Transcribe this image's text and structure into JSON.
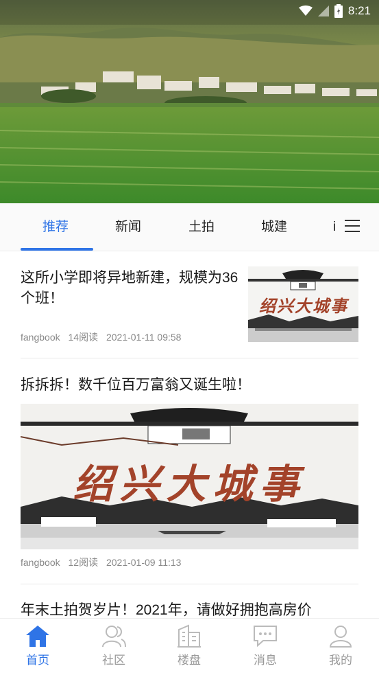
{
  "status": {
    "time": "8:21"
  },
  "tabs": [
    {
      "label": "推荐"
    },
    {
      "label": "新闻"
    },
    {
      "label": "土拍"
    },
    {
      "label": "城建"
    },
    {
      "label": "i"
    }
  ],
  "articles": [
    {
      "title": "这所小学即将异地新建，规模为36个班！",
      "author": "fangbook",
      "reads": "14阅读",
      "date": "2021-01-11 09:58",
      "banner_text": "绍兴大城事"
    },
    {
      "title": "拆拆拆！数千位百万富翁又诞生啦！",
      "author": "fangbook",
      "reads": "12阅读",
      "date": "2021-01-09 11:13",
      "banner_text": "绍兴大城事"
    },
    {
      "title": "年末土拍贺岁片！2021年，请做好拥抱高房价"
    }
  ],
  "bottom_nav": [
    {
      "label": "首页",
      "icon": "home-icon"
    },
    {
      "label": "社区",
      "icon": "community-icon"
    },
    {
      "label": "楼盘",
      "icon": "buildings-icon"
    },
    {
      "label": "消息",
      "icon": "message-icon"
    },
    {
      "label": "我的",
      "icon": "profile-icon"
    }
  ],
  "colors": {
    "accent": "#2f74e6",
    "banner_text": "#a3432a"
  }
}
